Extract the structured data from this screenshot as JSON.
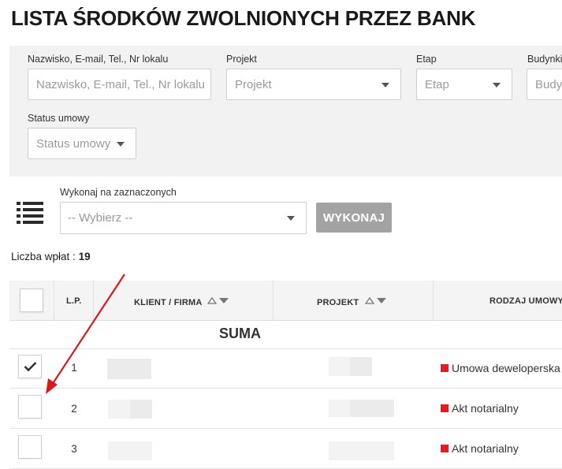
{
  "page": {
    "title": "LISTA ŚRODKÓW ZWOLNIONYCH PRZEZ BANK"
  },
  "filters": {
    "search": {
      "label": "Nazwisko, E-mail, Tel., Nr lokalu",
      "placeholder": "Nazwisko, E-mail, Tel., Nr lokalu"
    },
    "project": {
      "label": "Projekt",
      "value": "Projekt"
    },
    "stage": {
      "label": "Etap",
      "value": "Etap"
    },
    "building": {
      "label": "Budynki",
      "value": "Budy"
    },
    "contract_status": {
      "label": "Status umowy",
      "value": "Status umowy"
    }
  },
  "bulk": {
    "label": "Wykonaj na zaznaczonych",
    "select_value": "-- Wybierz --",
    "button": "WYKONAJ"
  },
  "count": {
    "label": "Liczba wpłat :",
    "value": "19"
  },
  "table": {
    "headers": {
      "lp": "L.P.",
      "client": "KLIENT / FIRMA",
      "project": "PROJEKT",
      "contract_type": "RODZAJ UMOWY"
    },
    "sum_label": "SUMA",
    "rows": [
      {
        "lp": "1",
        "checked": true,
        "contract_type": "Umowa deweloperska"
      },
      {
        "lp": "2",
        "checked": false,
        "contract_type": "Akt notarialny"
      },
      {
        "lp": "3",
        "checked": false,
        "contract_type": "Akt notarialny"
      }
    ]
  },
  "colors": {
    "accent_red": "#e01e24",
    "button_gray": "#a3a3a3",
    "panel_bg": "#f2f2f2",
    "annotation_arrow": "#d9181f"
  }
}
